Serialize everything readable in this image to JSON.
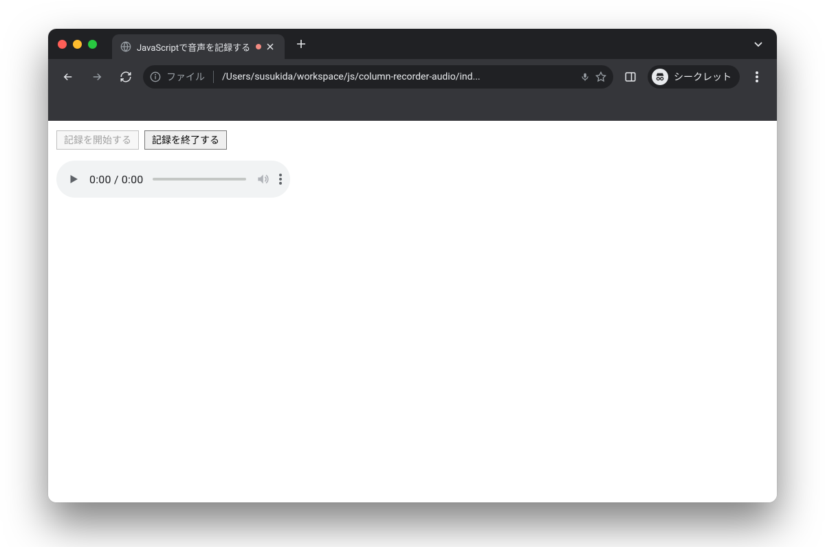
{
  "titlebar": {
    "tab_title": "JavaScriptで音声を記録する",
    "recording": true
  },
  "toolbar": {
    "file_label": "ファイル",
    "url": "/Users/susukida/workspace/js/column-recorder-audio/ind...",
    "incognito_label": "シークレット"
  },
  "page": {
    "start_button_label": "記録を開始する",
    "stop_button_label": "記録を終了する",
    "start_button_disabled": true,
    "stop_button_disabled": false
  },
  "audio": {
    "current_time": "0:00",
    "duration": "0:00"
  }
}
